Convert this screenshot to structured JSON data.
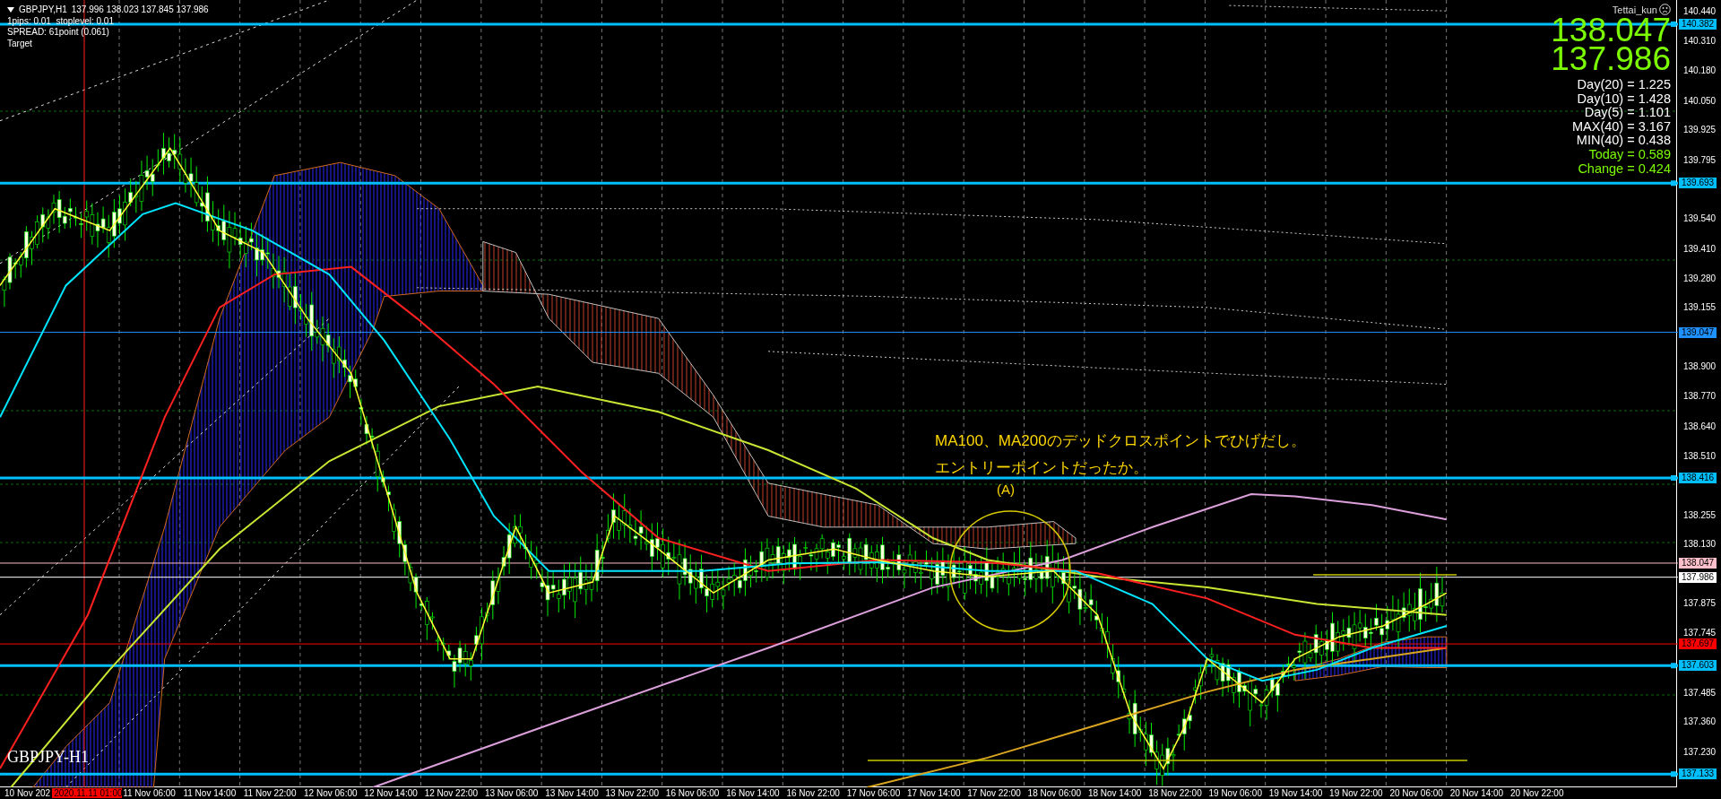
{
  "chart_header": {
    "symbol": "GBPJPY,H1",
    "ohlc": "137.996 138.023 137.845 137.986",
    "info_lines": [
      "1pips: 0.01  stoplevel: 0.01",
      "SPREAD: 61point (0.061)",
      "Target"
    ]
  },
  "info_panel": {
    "user": "Tettai_kun",
    "bid": "138.047",
    "ask": "137.986",
    "stats": [
      {
        "text": "Day(20) = 1.225",
        "color": "#ffffff"
      },
      {
        "text": "Day(10) = 1.428",
        "color": "#ffffff"
      },
      {
        "text": "Day(5) = 1.101",
        "color": "#ffffff"
      },
      {
        "text": "MAX(40) = 3.167",
        "color": "#ffffff"
      },
      {
        "text": "MIN(40) = 0.438",
        "color": "#ffffff"
      },
      {
        "text": "Today = 0.589",
        "color": "#7cfc00"
      },
      {
        "text": "Change = 0.424",
        "color": "#7cfc00"
      }
    ]
  },
  "annotation": {
    "lines": [
      "MA100、MA200のデッドクロスポイントでひげだし。",
      "エントリーポイントだったか。"
    ],
    "marker": "(A)"
  },
  "chart_label": "GBPJPY-H1",
  "price_axis": {
    "ticks": [
      "140.440",
      "140.310",
      "140.180",
      "140.050",
      "139.925",
      "139.795",
      "139.540",
      "139.410",
      "139.280",
      "139.155",
      "138.900",
      "138.770",
      "138.640",
      "138.510",
      "138.255",
      "138.130",
      "137.875",
      "137.745",
      "137.485",
      "137.360",
      "137.230"
    ],
    "tags": [
      {
        "price": "140.382",
        "color": "#00bfff",
        "thick": true
      },
      {
        "price": "139.693",
        "color": "#00bfff",
        "thick": true
      },
      {
        "price": "139.047",
        "color": "#1e90ff",
        "thick": false
      },
      {
        "price": "138.416",
        "color": "#00bfff",
        "thick": true
      },
      {
        "price": "138.047",
        "color": "#ffc0cb",
        "thick": false
      },
      {
        "price": "137.986",
        "color": "#ffffff",
        "thick": false
      },
      {
        "price": "137.697",
        "color": "#ff0000",
        "thick": false
      },
      {
        "price": "137.603",
        "color": "#00bfff",
        "thick": true
      },
      {
        "price": "137.133",
        "color": "#00bfff",
        "thick": true
      }
    ]
  },
  "time_axis": {
    "labels": [
      "10 Nov 202",
      "11 Nov 06:00",
      "11 Nov 14:00",
      "11 Nov 22:00",
      "12 Nov 06:00",
      "12 Nov 14:00",
      "12 Nov 22:00",
      "13 Nov 06:00",
      "13 Nov 14:00",
      "13 Nov 22:00",
      "16 Nov 06:00",
      "16 Nov 14:00",
      "16 Nov 22:00",
      "17 Nov 06:00",
      "17 Nov 14:00",
      "17 Nov 22:00",
      "18 Nov 06:00",
      "18 Nov 14:00",
      "18 Nov 22:00",
      "19 Nov 06:00",
      "19 Nov 14:00",
      "19 Nov 22:00",
      "20 Nov 06:00",
      "20 Nov 14:00",
      "20 Nov 22:00"
    ],
    "crosshair_time": "2020.11.11 01:00"
  }
}
